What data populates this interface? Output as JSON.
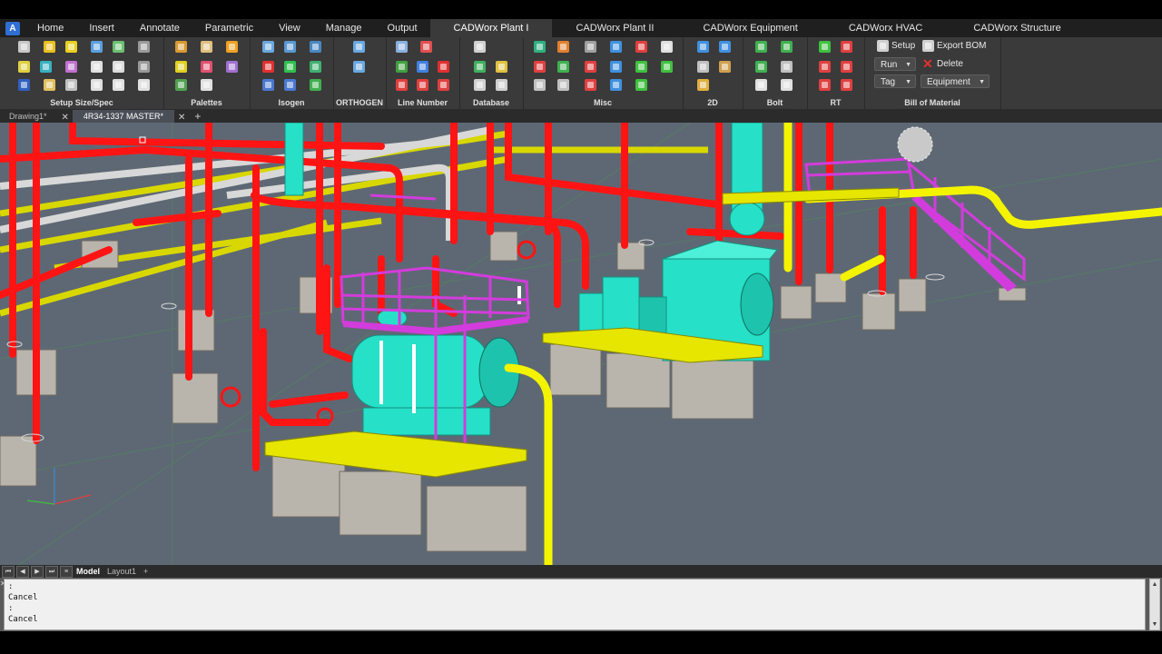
{
  "app": {
    "logo_glyph": "A"
  },
  "ribbon_tabs": [
    {
      "label": "Home"
    },
    {
      "label": "Insert"
    },
    {
      "label": "Annotate"
    },
    {
      "label": "Parametric"
    },
    {
      "label": "View"
    },
    {
      "label": "Manage"
    },
    {
      "label": "Output"
    },
    {
      "label": "CADWorx Plant I"
    },
    {
      "label": "CADWorx Plant II"
    },
    {
      "label": "CADWorx Equipment"
    },
    {
      "label": "CADWorx HVAC"
    },
    {
      "label": "CADWorx Structure"
    }
  ],
  "ribbon_panels": {
    "setup": "Setup Size/Spec",
    "palettes": "Palettes",
    "isogen": "Isogen",
    "orthogen": "ORTHOGEN",
    "line_number": "Line Number",
    "database": "Database",
    "misc": "Misc",
    "twod": "2D",
    "bolt": "Bolt",
    "rt": "RT",
    "bom": "Bill of Material"
  },
  "bom": {
    "setup_label": "Setup",
    "export_label": "Export BOM",
    "run_label": "Run",
    "delete_label": "Delete",
    "tag_label": "Tag",
    "equipment_label": "Equipment"
  },
  "doc_tabs": [
    {
      "label": "Drawing1*"
    },
    {
      "label": "4R34-1337 MASTER*"
    }
  ],
  "layout_tabs": [
    {
      "label": "Model"
    },
    {
      "label": "Layout1"
    }
  ],
  "command_history": [
    ":",
    "Cancel",
    ":",
    "Cancel"
  ],
  "colors": {
    "pipe_red": "#ff1414",
    "pipe_yellow": "#f4f400",
    "steel_magenta": "#d23cdc",
    "equipment_cyan": "#26e0c8",
    "foundation_gray": "#b9b5ad",
    "viewport_bg": "#5e6874"
  }
}
